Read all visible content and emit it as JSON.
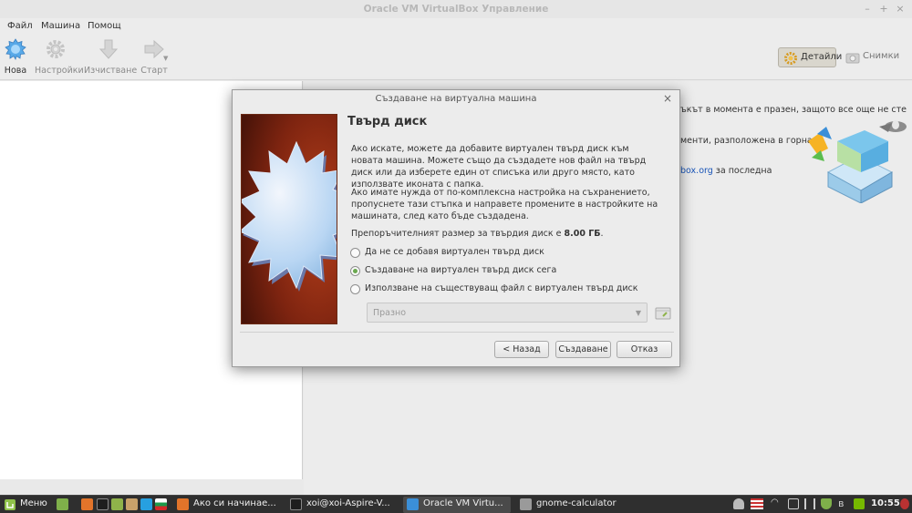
{
  "window": {
    "title": "Oracle VM VirtualBox Управление",
    "controls": [
      "–",
      "+",
      "×"
    ]
  },
  "menu": [
    "Файл",
    "Машина",
    "Помощ"
  ],
  "toolbar": {
    "new": "Нова",
    "settings": "Настройки",
    "discard": "Изчистване",
    "start": "Старт",
    "details": "Детайли",
    "snapshots": "Снимки"
  },
  "details_pane": {
    "line1": "ъкът в момента е празен, защото все още не сте",
    "line2": "менти, разположена в горната",
    "line3_link": "box.org",
    "line3_rest": " за последна"
  },
  "dialog": {
    "title": "Създаване на виртуална машина",
    "close": "×",
    "heading": "Твърд диск",
    "para1": "Ако искате, можете да добавите виртуален твърд диск към новата машина. Можете също да създадете нов файл на твърд диск или да изберете един от списъка или друго място, като използвате иконата с папка.",
    "para2": "Ако имате нужда от по-комплексна настройка на съхранението, пропуснете тази стъпка и направете промените в настройките на машината, след като бъде създадена.",
    "recommend_prefix": "Препоръчителният размер за твърдия диск е ",
    "recommend_size": "8.00 ГБ",
    "recommend_suffix": ".",
    "options": [
      {
        "label": "Да не се добавя виртуален твърд диск",
        "selected": false
      },
      {
        "label": "Създаване на виртуален твърд диск сега",
        "selected": true
      },
      {
        "label": "Използване на съществуващ файл с виртуален твърд диск",
        "selected": false
      }
    ],
    "combo_value": "Празно",
    "buttons": {
      "back": "< Назад",
      "create": "Създаване",
      "cancel": "Отказ"
    }
  },
  "taskbar": {
    "menu": "Меню",
    "apps": [
      {
        "label": "Ако си начинае...",
        "active": false
      },
      {
        "label": "xoi@xoi-Aspire-V...",
        "active": false
      },
      {
        "label": "Oracle VM Virtu...",
        "active": true
      },
      {
        "label": "gnome-calculator",
        "active": false
      }
    ],
    "clock": "10:55"
  },
  "colors": {
    "accent_green": "#6aa84f",
    "link_blue": "#1a55b8",
    "taskbar_bg": "#2f2f2f",
    "wizard_red": "#8a2a12"
  }
}
